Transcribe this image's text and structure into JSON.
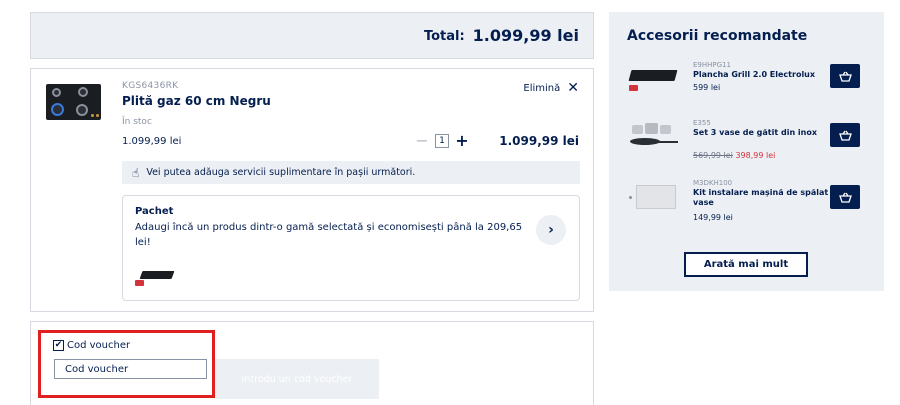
{
  "total": {
    "label": "Total:",
    "value": "1.099,99 lei"
  },
  "product": {
    "sku": "KGS6436RK",
    "name": "Plită gaz 60 cm Negru",
    "remove_label": "Elimină",
    "stock": "În stoc",
    "unit_price": "1.099,99 lei",
    "quantity": "1",
    "line_total": "1.099,99 lei",
    "services_info": "Vei putea adăuga servicii suplimentare în pașii următori."
  },
  "pack": {
    "title": "Pachet",
    "description": "Adaugi încă un produs dintr-o gamă selectată și economisești până la 209,65 lei!"
  },
  "voucher": {
    "checkbox_label": "Cod voucher",
    "checked": true,
    "placeholder": "Cod voucher",
    "button_label": "Introdu un cod voucher"
  },
  "sidebar": {
    "title": "Accesorii recomandate",
    "items": [
      {
        "sku": "E9HHPG11",
        "name": "Plancha Grill 2.0 Electrolux",
        "price": "599 lei"
      },
      {
        "sku": "E355",
        "name": "Set 3 vase de gătit din inox",
        "old_price": "569,99 lei",
        "new_price": "398,99 lei"
      },
      {
        "sku": "M3DKH100",
        "name": "Kit instalare mașină de spălat vase",
        "price": "149,99 lei"
      }
    ],
    "show_more_label": "Arată mai mult"
  },
  "colors": {
    "navy": "#041e50",
    "panel": "#eceff3",
    "sale_red": "#d3333d",
    "highlight_red": "#e02020"
  }
}
